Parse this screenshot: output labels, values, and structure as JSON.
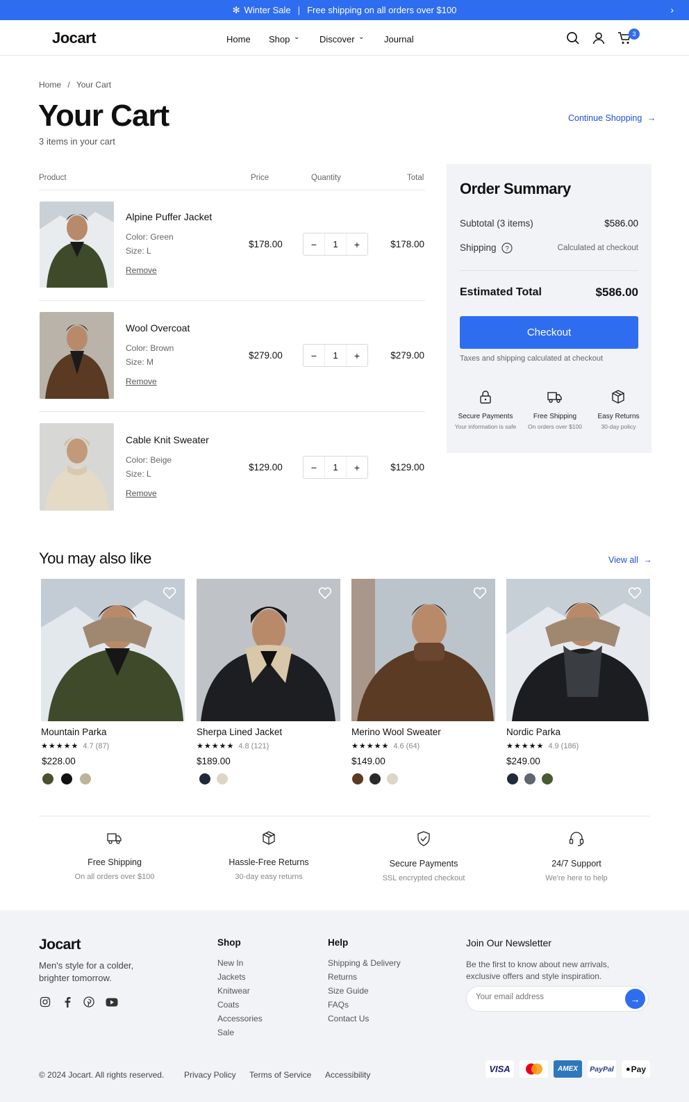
{
  "promo": {
    "icon": "snowflake-icon",
    "text": "Winter Sale",
    "separator": "|",
    "detail": "Free shipping on all orders over $100"
  },
  "header": {
    "logo": "Jocart",
    "nav": [
      {
        "label": "Home"
      },
      {
        "label": "Shop"
      },
      {
        "label": "Discover"
      },
      {
        "label": "Journal"
      }
    ],
    "cart_count": "3"
  },
  "breadcrumb": {
    "home": "Home",
    "sep": "/",
    "current": "Your Cart"
  },
  "page": {
    "title": "Your Cart",
    "subtitle": "3 items in your cart",
    "continue": "Continue Shopping"
  },
  "table": {
    "headers": {
      "product": "Product",
      "price": "Price",
      "quantity": "Quantity",
      "total": "Total"
    }
  },
  "cart_items": [
    {
      "name": "Alpine Puffer Jacket",
      "color": "Color: Green",
      "size": "Size: L",
      "remove": "Remove",
      "price": "$178.00",
      "qty": "1",
      "total": "$178.00",
      "coat": "#3f4a2a"
    },
    {
      "name": "Wool Overcoat",
      "color": "Color: Brown",
      "size": "Size: M",
      "remove": "Remove",
      "price": "$279.00",
      "qty": "1",
      "total": "$279.00",
      "coat": "#5a3a22"
    },
    {
      "name": "Cable Knit Sweater",
      "color": "Color: Beige",
      "size": "Size: L",
      "remove": "Remove",
      "price": "$129.00",
      "qty": "1",
      "total": "$129.00",
      "coat": "#e4dac6"
    }
  ],
  "summary": {
    "title": "Order Summary",
    "subtotal_label": "Subtotal (3 items)",
    "subtotal": "$586.00",
    "shipping_label": "Shipping",
    "shipping_value": "Calculated at checkout",
    "total_label": "Estimated Total",
    "total": "$586.00",
    "checkout": "Checkout",
    "note": "Taxes and shipping calculated at checkout",
    "features": [
      {
        "icon": "lock-icon",
        "title": "Secure Payments",
        "sub": "Your information is safe"
      },
      {
        "icon": "truck-icon",
        "title": "Free Shipping",
        "sub": "On orders over $100"
      },
      {
        "icon": "box-icon",
        "title": "Easy Returns",
        "sub": "30-day policy"
      }
    ]
  },
  "recommend": {
    "title": "You may also like",
    "view_all": "View all",
    "products": [
      {
        "name": "Mountain Parka",
        "stars": "★★★★★",
        "rating": "4.7 (87)",
        "price": "$228.00",
        "swatches": [
          "#4a5030",
          "#111111",
          "#bfb29a"
        ],
        "coat": "#3f4a2a"
      },
      {
        "name": "Sherpa Lined Jacket",
        "stars": "★★★★★",
        "rating": "4.8 (121)",
        "price": "$189.00",
        "swatches": [
          "#1f2937",
          "#ddd5c5"
        ],
        "coat": "#1c1e22"
      },
      {
        "name": "Merino Wool Sweater",
        "stars": "★★★★★",
        "rating": "4.6 (64)",
        "price": "$149.00",
        "swatches": [
          "#5a3a22",
          "#2a2a2a",
          "#ddd5c5"
        ],
        "coat": "#5b3b24"
      },
      {
        "name": "Nordic Parka",
        "stars": "★★★★★",
        "rating": "4.9 (186)",
        "price": "$249.00",
        "swatches": [
          "#1f2a3a",
          "#5f6670",
          "#4a5a30"
        ],
        "coat": "#1b1d21"
      }
    ]
  },
  "services": [
    {
      "icon": "truck-icon",
      "title": "Free Shipping",
      "sub": "On all orders over $100"
    },
    {
      "icon": "box-icon",
      "title": "Hassle-Free Returns",
      "sub": "30-day easy returns"
    },
    {
      "icon": "shield-check-icon",
      "title": "Secure Payments",
      "sub": "SSL encrypted checkout"
    },
    {
      "icon": "headset-icon",
      "title": "24/7 Support",
      "sub": "We're here to help"
    }
  ],
  "footer": {
    "logo": "Jocart",
    "tagline_1": "Men's style for a colder,",
    "tagline_2": "brighter tomorrow.",
    "shop": {
      "title": "Shop",
      "links": [
        "New In",
        "Jackets",
        "Knitwear",
        "Coats",
        "Accessories",
        "Sale"
      ]
    },
    "help": {
      "title": "Help",
      "links": [
        "Shipping & Delivery",
        "Returns",
        "Size Guide",
        "FAQs",
        "Contact Us"
      ]
    },
    "newsletter": {
      "title": "Join Our Newsletter",
      "text_1": "Be the first to know about new arrivals,",
      "text_2": "exclusive offers and style inspiration.",
      "placeholder": "Your email address"
    },
    "copyright": "© 2024 Jocart. All rights reserved.",
    "legal": [
      "Privacy Policy",
      "Terms of Service",
      "Accessibility"
    ],
    "payments": [
      "VISA",
      "AMEX",
      "PayPal",
      "Pay"
    ]
  }
}
